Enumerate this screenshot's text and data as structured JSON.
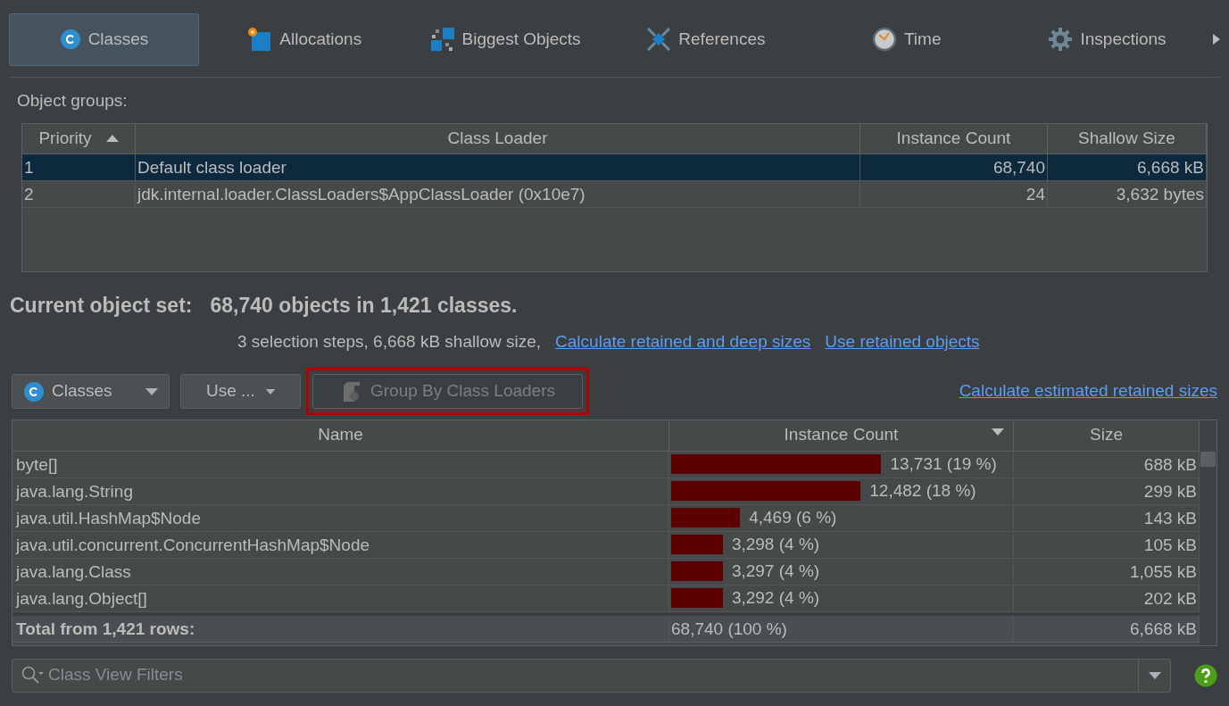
{
  "tabs": [
    {
      "label": "Classes",
      "kind": "classes",
      "selected": true
    },
    {
      "label": "Allocations",
      "kind": "allocations",
      "selected": false
    },
    {
      "label": "Biggest Objects",
      "kind": "biggest",
      "selected": false
    },
    {
      "label": "References",
      "kind": "references",
      "selected": false
    },
    {
      "label": "Time",
      "kind": "time",
      "selected": false
    },
    {
      "label": "Inspections",
      "kind": "inspections",
      "selected": false
    }
  ],
  "object_groups": {
    "label": "Object groups:",
    "columns": [
      "Priority",
      "Class Loader",
      "Instance Count",
      "Shallow Size"
    ],
    "rows": [
      {
        "cells": [
          "1",
          "Default class loader",
          "68,740",
          "6,668 kB"
        ],
        "selected": true
      },
      {
        "cells": [
          "2",
          "jdk.internal.loader.ClassLoaders$AppClassLoader (0x10e7)",
          "24",
          "3,632 bytes"
        ],
        "selected": false
      }
    ]
  },
  "current_set": {
    "label": "Current object set:",
    "value": "68,740 objects in 1,421 classes.",
    "details": "3 selection steps, 6,668 kB shallow size,",
    "links": [
      "Calculate retained and deep sizes",
      "Use retained objects"
    ]
  },
  "toolbar": {
    "view_dropdown": "Classes",
    "use_dropdown": "Use ...",
    "group_button": {
      "label": "Group By Class Loaders",
      "disabled": true,
      "highlighted": true
    },
    "link": "Calculate estimated retained sizes"
  },
  "classes_table": {
    "columns": [
      "Name",
      "Instance Count",
      "Size"
    ],
    "rows": [
      {
        "name": "byte[]",
        "count": "13,731 (19 %)",
        "level": 0.61,
        "size": "688 kB"
      },
      {
        "name": "java.lang.String",
        "count": "12,482 (18 %)",
        "level": 0.55,
        "size": "299 kB"
      },
      {
        "name": "java.util.HashMap$Node",
        "count": "4,469 (6 %)",
        "level": 0.2,
        "size": "143 kB"
      },
      {
        "name": "java.util.concurrent.ConcurrentHashMap$Node",
        "count": "3,298 (4 %)",
        "level": 0.15,
        "size": "105 kB"
      },
      {
        "name": "java.lang.Class",
        "count": "3,297 (4 %)",
        "level": 0.15,
        "size": "1,055 kB"
      },
      {
        "name": "java.lang.Object[]",
        "count": "3,292 (4 %)",
        "level": 0.15,
        "size": "202 kB"
      }
    ],
    "total": {
      "name": "Total from 1,421 rows:",
      "count": "68,740 (100 %)",
      "size": "6,668 kB"
    }
  },
  "filter": {
    "placeholder": "Class View Filters"
  }
}
